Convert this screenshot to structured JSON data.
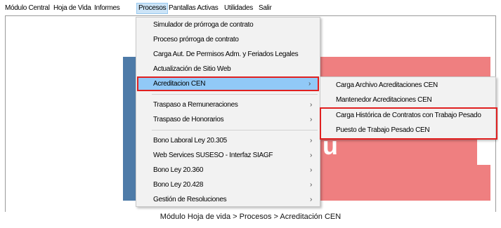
{
  "menubar": {
    "items": [
      "Módulo Central",
      "Hoja de Vida",
      "Informes",
      "Procesos",
      "Pantallas Activas",
      "Utilidades",
      "Salir"
    ]
  },
  "procesos_menu": {
    "items": [
      "Simulador de prórroga de contrato",
      "Proceso prórroga de contrato",
      "Carga Aut. De Permisos Adm. y Feriados Legales",
      "Actualización de Sitio Web",
      "Acreditacion CEN",
      "Traspaso a Remuneraciones",
      "Traspaso de Honorarios",
      "Bono Laboral Ley 20.305",
      "Web Services SUSESO - Interfaz SIAGF",
      "Bono Ley 20.360",
      "Bono Ley 20.428",
      "Gestión de Resoluciones"
    ],
    "submenu_arrow": "›"
  },
  "acreditacion_submenu": {
    "items": [
      "Carga Archivo Acreditaciones CEN",
      "Mantenedor Acreditaciones CEN",
      "Carga Histórica de Contratos con Trabajo Pesado",
      "Puesto de Trabajo Pesado CEN"
    ]
  },
  "background": {
    "letter": "u"
  },
  "caption": "Módulo Hoja de vida > Procesos > Acreditación CEN",
  "colors": {
    "highlight": "#91c9f7",
    "annotation_red": "#e02020",
    "background_panel": "#ef7f80",
    "menu_bg": "#f2f2f2"
  }
}
